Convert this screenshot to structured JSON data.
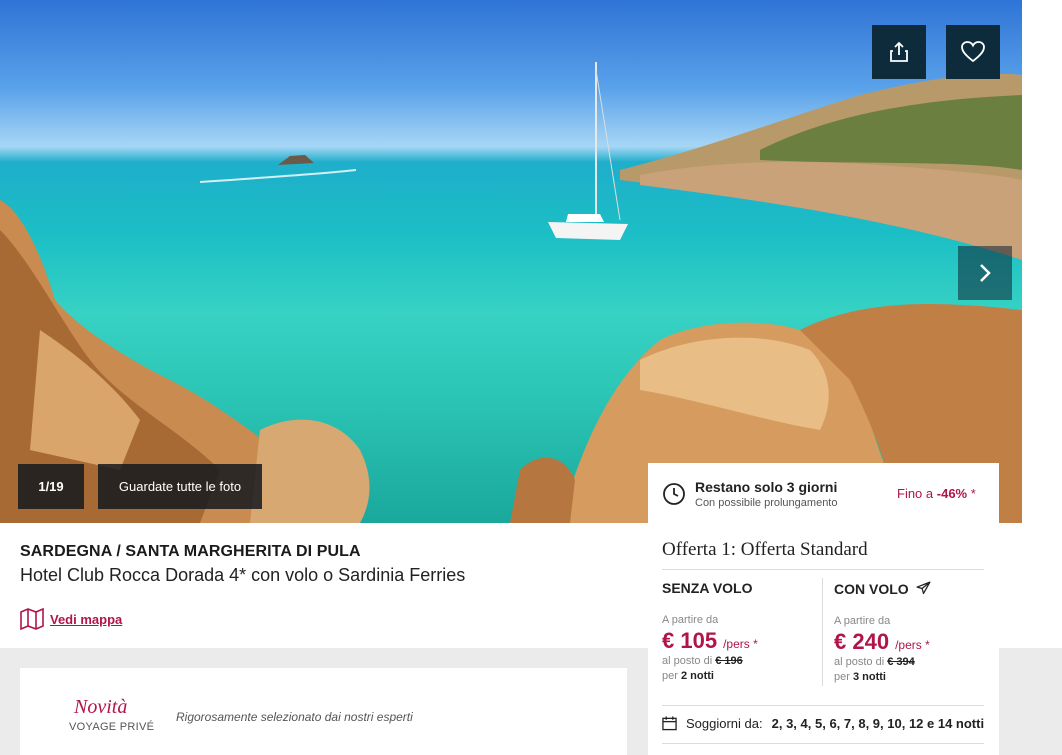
{
  "gallery": {
    "counter": "1/19",
    "see_all_label": "Guardate tutte le foto"
  },
  "header": {
    "location": "SARDEGNA / SANTA MARGHERITA DI PULA",
    "hotel_name": "Hotel Club Rocca Dorada 4* con volo o Sardinia Ferries",
    "map_link": "Vedi mappa"
  },
  "novita": {
    "title": "Novità",
    "subtitle": "VOYAGE PRIVÉ",
    "text": "Rigorosamente selezionato dai nostri esperti"
  },
  "panel": {
    "remaining": "Restano solo 3 giorni",
    "extension": "Con possibile prolungamento",
    "discount_prefix": "Fino a",
    "discount_value": "-46%",
    "discount_suffix": "*",
    "offer_title": "Offerta 1: Offerta Standard",
    "without_flight": {
      "title": "SENZA VOLO",
      "from": "A partire da",
      "price": "€ 105",
      "per": "/pers *",
      "instead_prefix": "al posto di",
      "old_price": "€ 196",
      "nights_prefix": "per",
      "nights": "2 notti"
    },
    "with_flight": {
      "title": "CON VOLO",
      "from": "A partire da",
      "price": "€ 240",
      "per": "/pers *",
      "instead_prefix": "al posto di",
      "old_price": "€ 394",
      "nights_prefix": "per",
      "nights": "3 notti"
    },
    "stays_label": "Soggiorni da:",
    "stays_values": "2, 3, 4, 5, 6, 7, 8, 9, 10, 12 e 14 notti"
  },
  "colors": {
    "brand": "#b0144a",
    "dark_button": "#0d2b3a",
    "band": "#ebebeb"
  },
  "icons": [
    "share-icon",
    "heart-icon",
    "chevron-right-icon",
    "map-icon",
    "clock-icon",
    "airplane-icon",
    "calendar-icon"
  ]
}
